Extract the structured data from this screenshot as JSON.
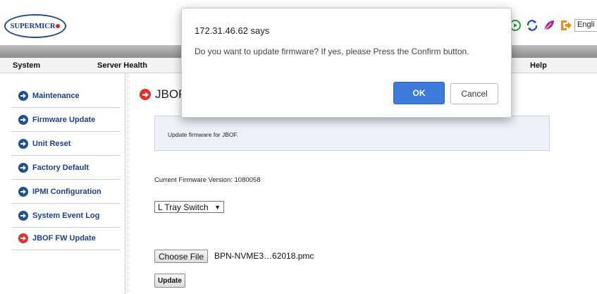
{
  "header": {
    "logo_text": "SUPERMICR",
    "language": "Engli",
    "icons": [
      "refresh-green-icon",
      "sync-icon",
      "leaf-icon",
      "logout-icon"
    ]
  },
  "nav": {
    "items": [
      "System",
      "Server Health",
      "Help"
    ]
  },
  "sidebar": {
    "items": [
      {
        "label": "Maintenance"
      },
      {
        "label": "Firmware Update"
      },
      {
        "label": "Unit Reset"
      },
      {
        "label": "Factory Default"
      },
      {
        "label": "IPMI Configuration"
      },
      {
        "label": "System Event Log"
      },
      {
        "label": "JBOF FW Update"
      }
    ],
    "active_index": 6
  },
  "main": {
    "title": "JBOF",
    "info_text": "Update firmware for JBOF.",
    "firmware_version_label": "Current Firmware Version: 1080058",
    "tray_select_value": "L Tray Switch",
    "choose_file_label": "Choose File",
    "file_name": "BPN-NVME3…62018.pmc",
    "update_label": "Update"
  },
  "dialog": {
    "title": "172.31.46.62 says",
    "message": "Do you want to update firmware? If yes, please Press the Confirm button.",
    "ok_label": "OK",
    "cancel_label": "Cancel"
  },
  "colors": {
    "accent_blue": "#1d3f8f",
    "active_red": "#e0312d",
    "ok_button": "#3c7bd8"
  }
}
